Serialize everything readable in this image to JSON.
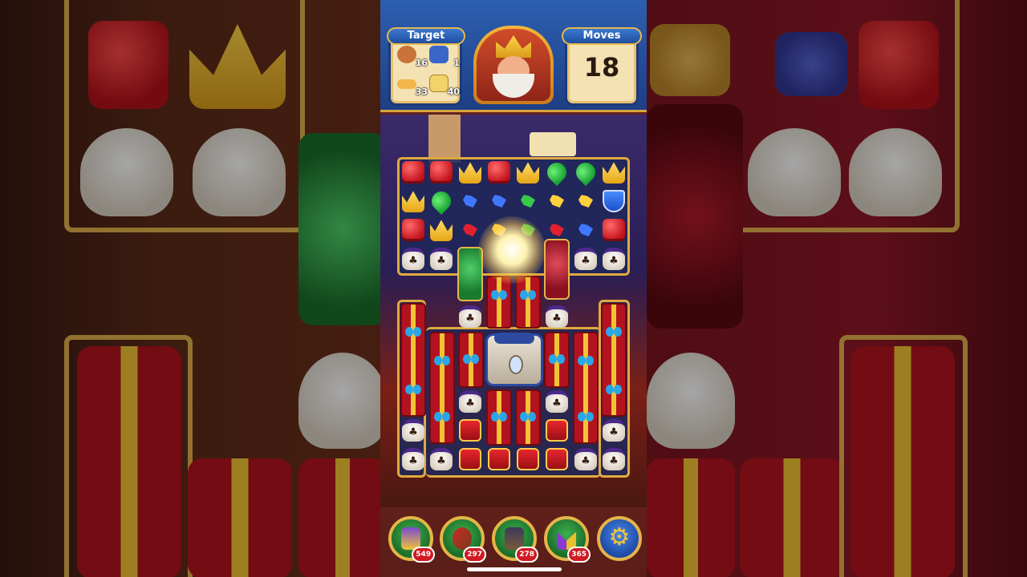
{
  "hud": {
    "target_label": "Target",
    "moves_label": "Moves",
    "moves_value": "18",
    "targets": [
      {
        "name": "toy-bear",
        "count": "16",
        "icon": "bear-icon",
        "color": "#c9733a"
      },
      {
        "name": "salt-machine",
        "count": "1",
        "icon": "jar-machine-icon",
        "color": "#3a66c9"
      },
      {
        "name": "bone",
        "count": "33",
        "icon": "bone-icon",
        "color": "#f2b54a"
      },
      {
        "name": "envelope",
        "count": "40",
        "icon": "envelope-icon",
        "color": "#f2d36a"
      }
    ]
  },
  "boosters": [
    {
      "name": "hammer-booster",
      "count": "549",
      "icon": "hammer-icon"
    },
    {
      "name": "arrow-booster",
      "count": "297",
      "icon": "bow-arrow-icon"
    },
    {
      "name": "cannon-booster",
      "count": "278",
      "icon": "cannon-icon"
    },
    {
      "name": "jester-booster",
      "count": "365",
      "icon": "jester-hat-icon"
    }
  ],
  "settings": {
    "icon": "gear-icon",
    "glyph": "⚙"
  },
  "colors": {
    "hud": "#2d5fb0",
    "gold": "#e0a940",
    "board": "#1e285a"
  }
}
